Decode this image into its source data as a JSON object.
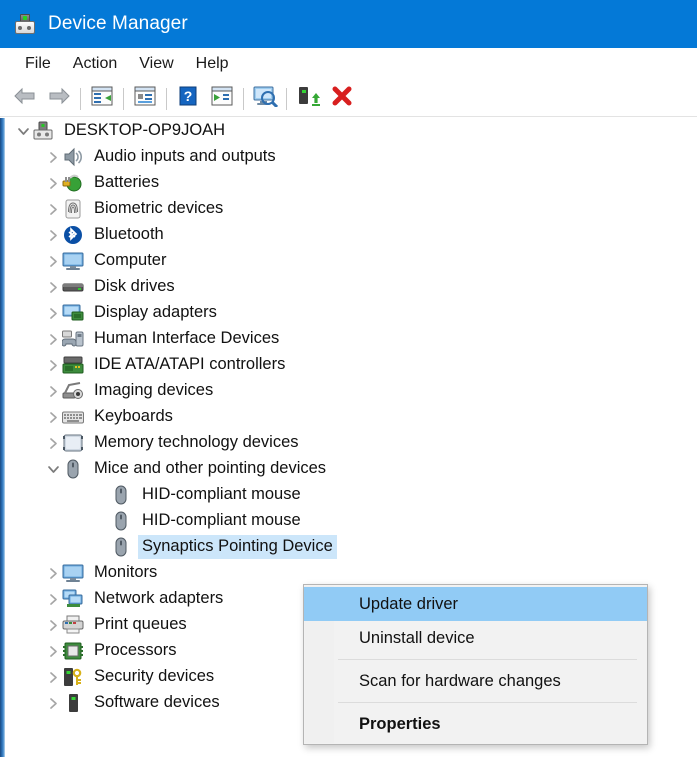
{
  "window": {
    "title": "Device Manager",
    "title_icon": "device-manager-icon",
    "titlebar_color": "#0479d7"
  },
  "menubar": {
    "items": [
      {
        "label": "File",
        "name": "menu-file"
      },
      {
        "label": "Action",
        "name": "menu-action"
      },
      {
        "label": "View",
        "name": "menu-view"
      },
      {
        "label": "Help",
        "name": "menu-help"
      }
    ]
  },
  "toolbar": {
    "buttons": [
      {
        "icon": "back-arrow-icon",
        "name": "toolbar-back"
      },
      {
        "icon": "forward-arrow-icon",
        "name": "toolbar-forward"
      },
      {
        "icon": "show-hide-console-tree-icon",
        "name": "toolbar-console-tree"
      },
      {
        "icon": "properties-icon",
        "name": "toolbar-properties"
      },
      {
        "icon": "help-icon",
        "name": "toolbar-help"
      },
      {
        "icon": "update-driver-software-icon",
        "name": "toolbar-update-driver"
      },
      {
        "icon": "scan-for-hardware-changes-icon",
        "name": "toolbar-scan-hardware"
      },
      {
        "icon": "enable-device-icon",
        "name": "toolbar-enable-device"
      },
      {
        "icon": "uninstall-device-icon",
        "name": "toolbar-uninstall-device"
      }
    ]
  },
  "tree": {
    "selection_color": "#cce6fa",
    "nodes": [
      {
        "label": "DESKTOP-OP9JOAH",
        "indent": 0,
        "state": "expanded",
        "icon": "computer-root-icon",
        "selected": false
      },
      {
        "label": "Audio inputs and outputs",
        "indent": 1,
        "state": "collapsed",
        "icon": "speaker-icon",
        "selected": false
      },
      {
        "label": "Batteries",
        "indent": 1,
        "state": "collapsed",
        "icon": "battery-icon",
        "selected": false
      },
      {
        "label": "Biometric devices",
        "indent": 1,
        "state": "collapsed",
        "icon": "fingerprint-icon",
        "selected": false
      },
      {
        "label": "Bluetooth",
        "indent": 1,
        "state": "collapsed",
        "icon": "bluetooth-icon",
        "selected": false
      },
      {
        "label": "Computer",
        "indent": 1,
        "state": "collapsed",
        "icon": "monitor-icon",
        "selected": false
      },
      {
        "label": "Disk drives",
        "indent": 1,
        "state": "collapsed",
        "icon": "disk-drive-icon",
        "selected": false
      },
      {
        "label": "Display adapters",
        "indent": 1,
        "state": "collapsed",
        "icon": "display-adapter-icon",
        "selected": false
      },
      {
        "label": "Human Interface Devices",
        "indent": 1,
        "state": "collapsed",
        "icon": "hid-icon",
        "selected": false
      },
      {
        "label": "IDE ATA/ATAPI controllers",
        "indent": 1,
        "state": "collapsed",
        "icon": "ide-controller-icon",
        "selected": false
      },
      {
        "label": "Imaging devices",
        "indent": 1,
        "state": "collapsed",
        "icon": "imaging-device-icon",
        "selected": false
      },
      {
        "label": "Keyboards",
        "indent": 1,
        "state": "collapsed",
        "icon": "keyboard-icon",
        "selected": false
      },
      {
        "label": "Memory technology devices",
        "indent": 1,
        "state": "collapsed",
        "icon": "memory-card-icon",
        "selected": false
      },
      {
        "label": "Mice and other pointing devices",
        "indent": 1,
        "state": "expanded",
        "icon": "mouse-icon",
        "selected": false
      },
      {
        "label": "HID-compliant mouse",
        "indent": 2,
        "state": "leaf",
        "icon": "mouse-icon",
        "selected": false
      },
      {
        "label": "HID-compliant mouse",
        "indent": 2,
        "state": "leaf",
        "icon": "mouse-icon",
        "selected": false
      },
      {
        "label": "Synaptics Pointing Device",
        "indent": 2,
        "state": "leaf",
        "icon": "mouse-icon",
        "selected": true
      },
      {
        "label": "Monitors",
        "indent": 1,
        "state": "collapsed",
        "icon": "monitor-icon",
        "selected": false
      },
      {
        "label": "Network adapters",
        "indent": 1,
        "state": "collapsed",
        "icon": "network-adapter-icon",
        "selected": false
      },
      {
        "label": "Print queues",
        "indent": 1,
        "state": "collapsed",
        "icon": "printer-icon",
        "selected": false
      },
      {
        "label": "Processors",
        "indent": 1,
        "state": "collapsed",
        "icon": "processor-icon",
        "selected": false
      },
      {
        "label": "Security devices",
        "indent": 1,
        "state": "collapsed",
        "icon": "security-device-icon",
        "selected": false
      },
      {
        "label": "Software devices",
        "indent": 1,
        "state": "collapsed",
        "icon": "software-device-icon",
        "selected": false
      }
    ]
  },
  "context_menu": {
    "highlight_color": "#91cbf5",
    "items": [
      {
        "label": "Update driver",
        "name": "ctx-update-driver",
        "highlighted": true,
        "bold": false
      },
      {
        "label": "Uninstall device",
        "name": "ctx-uninstall-device",
        "highlighted": false,
        "bold": false
      },
      {
        "separator_after": true
      },
      {
        "label": "Scan for hardware changes",
        "name": "ctx-scan-hardware-changes",
        "highlighted": false,
        "bold": false
      },
      {
        "separator_after": true
      },
      {
        "label": "Properties",
        "name": "ctx-properties",
        "highlighted": false,
        "bold": true
      }
    ]
  }
}
